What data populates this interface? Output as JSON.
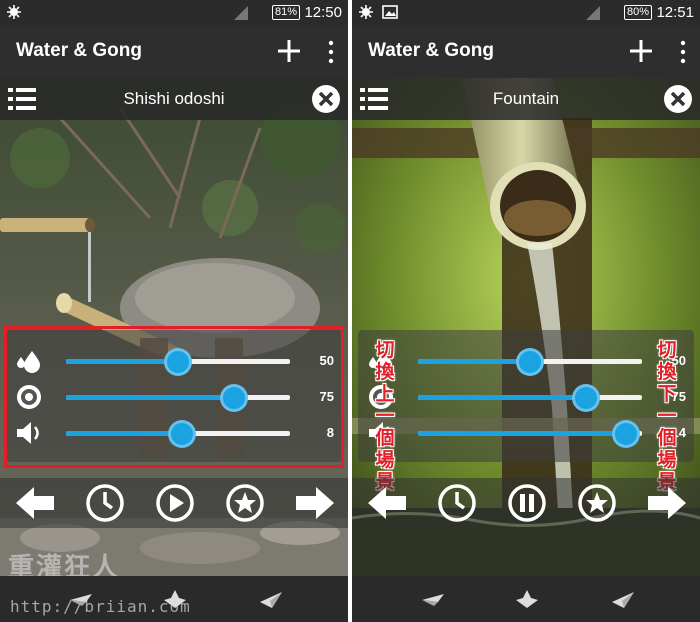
{
  "left_screen": {
    "status": {
      "battery": "81%",
      "time": "12:50",
      "left_icons": [
        "gear-icon"
      ]
    },
    "app_title": "Water & Gong",
    "scene_title": "Shishi odoshi",
    "sliders": [
      {
        "icon": "drops-icon",
        "value": "50",
        "level": 0.5
      },
      {
        "icon": "target-icon",
        "value": "75",
        "level": 0.75
      },
      {
        "icon": "speaker-icon",
        "value": "8",
        "level": 0.52
      }
    ],
    "controls": [
      "prev-scene-icon",
      "timer-icon",
      "play-icon",
      "favorite-icon",
      "next-scene-icon"
    ],
    "watermark_text": "重灌狂人",
    "watermark_url": "http://briian.com"
  },
  "right_screen": {
    "status": {
      "battery": "80%",
      "time": "12:51",
      "left_icons": [
        "gear-icon",
        "image-icon"
      ]
    },
    "app_title": "Water & Gong",
    "scene_title": "Fountain",
    "sliders": [
      {
        "icon": "drops-icon",
        "value": "50",
        "level": 0.5
      },
      {
        "icon": "target-icon",
        "value": "75",
        "level": 0.75
      },
      {
        "icon": "speaker-icon",
        "value": "14",
        "level": 0.93
      }
    ],
    "controls": [
      "prev-scene-icon",
      "timer-icon",
      "pause-icon",
      "favorite-icon",
      "next-scene-icon"
    ]
  },
  "annotations": {
    "prev_label": "切換上一個場景",
    "next_label": "切換下一個場景"
  },
  "colors": {
    "accent": "#1aa3e0",
    "annotation_red": "#e21f26",
    "appbar": "#2e2e2e",
    "statusbar": "#2b2b2b"
  }
}
